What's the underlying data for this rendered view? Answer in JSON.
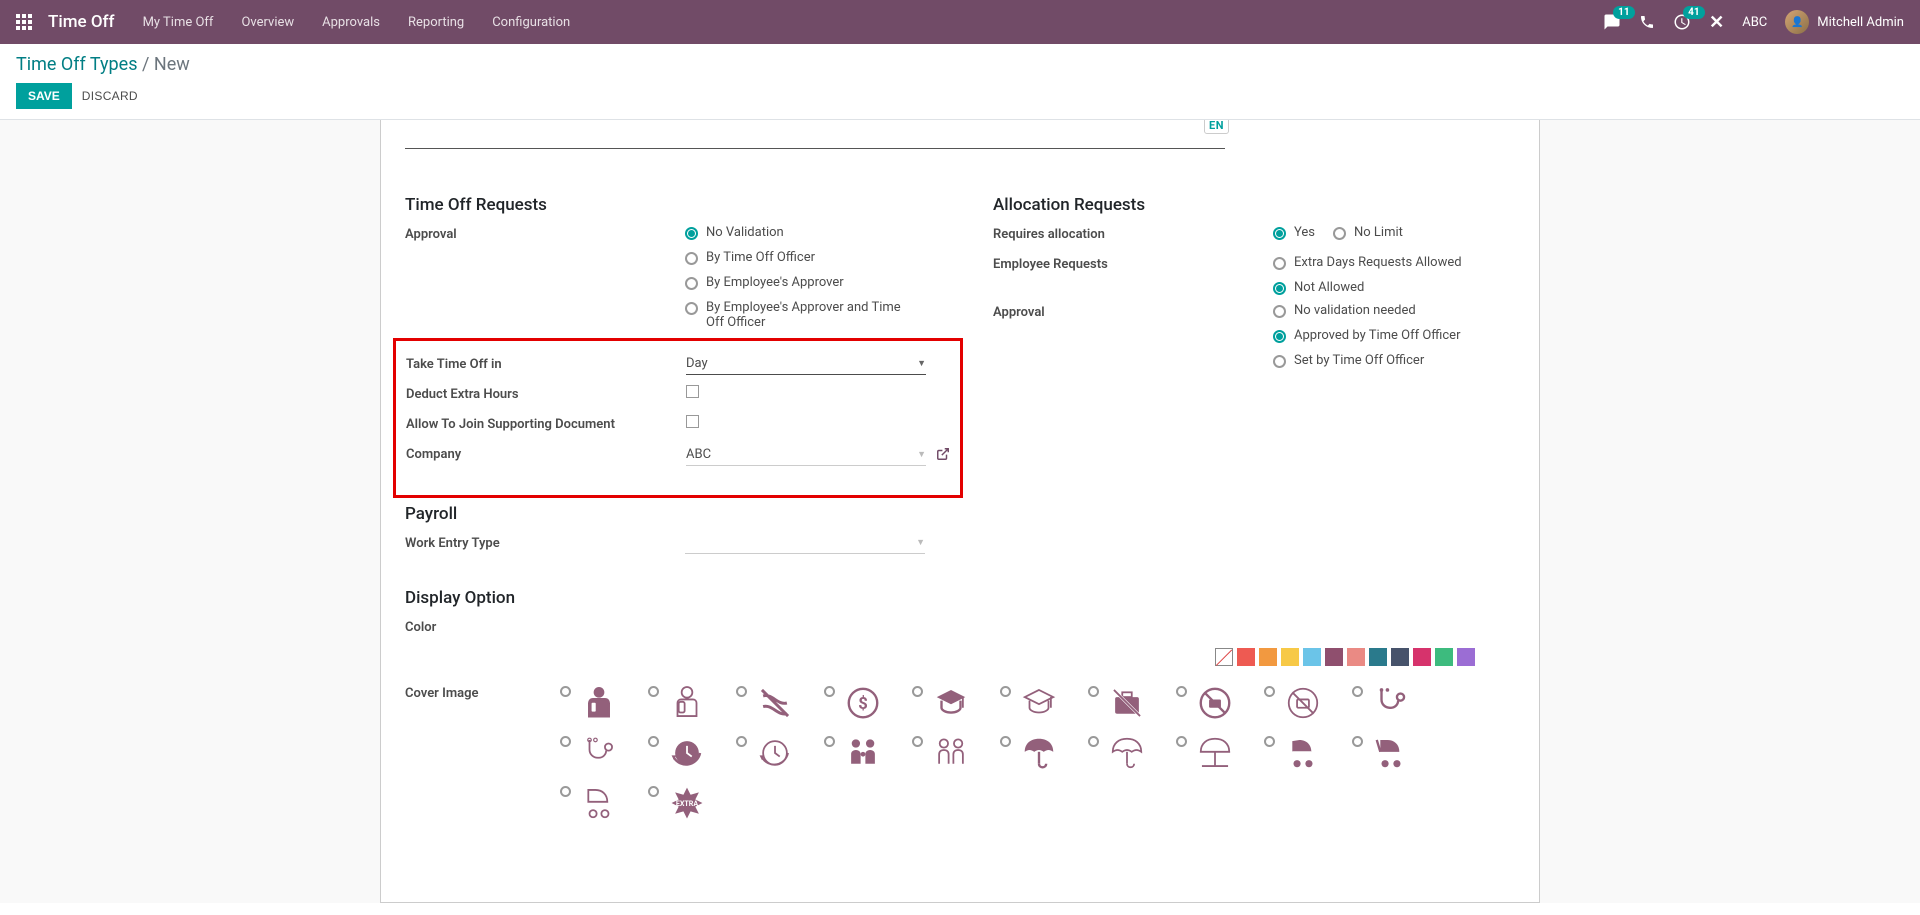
{
  "nav": {
    "app": "Time Off",
    "links": [
      "My Time Off",
      "Overview",
      "Approvals",
      "Reporting",
      "Configuration"
    ],
    "msg_badge": "11",
    "activities_badge": "41",
    "company": "ABC",
    "user": "Mitchell Admin"
  },
  "cpanel": {
    "breadcrumb_root": "Time Off Types",
    "breadcrumb_sep": " / ",
    "breadcrumb_leaf": "New",
    "save": "SAVE",
    "discard": "DISCARD",
    "lang": "EN"
  },
  "left": {
    "section": "Time Off Requests",
    "approval_label": "Approval",
    "approval_opts": [
      "No Validation",
      "By Time Off Officer",
      "By Employee's Approver",
      "By Employee's Approver and Time Off Officer"
    ],
    "unit_label": "Take Time Off in",
    "unit_value": "Day",
    "deduct_label": "Deduct Extra Hours",
    "support_label": "Allow To Join Supporting Document",
    "company_label": "Company",
    "company_value": "ABC",
    "payroll_section": "Payroll",
    "work_entry_label": "Work Entry Type",
    "display_section": "Display Option",
    "color_label": "Color",
    "cover_label": "Cover Image"
  },
  "right": {
    "section": "Allocation Requests",
    "requires_label": "Requires allocation",
    "requires_opts": [
      "Yes",
      "No Limit"
    ],
    "emp_req_label": "Employee Requests",
    "emp_req_opts": [
      "Extra Days Requests Allowed",
      "Not Allowed"
    ],
    "approval_label": "Approval",
    "approval_opts": [
      "No validation needed",
      "Approved by Time Off Officer",
      "Set by Time Off Officer"
    ]
  },
  "colors": [
    "#ee5a52",
    "#f29940",
    "#f7c947",
    "#6bc4e8",
    "#8f4f6e",
    "#ea8a84",
    "#2a7a8c",
    "#47536b",
    "#d6336c",
    "#3dbb7e",
    "#9b6dd4"
  ]
}
